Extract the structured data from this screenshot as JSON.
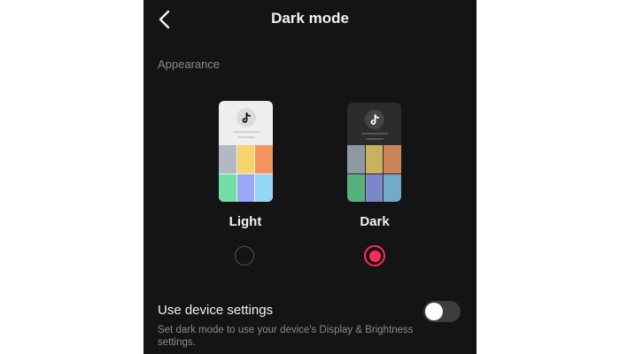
{
  "header": {
    "title": "Dark mode"
  },
  "appearance": {
    "label": "Appearance",
    "options": [
      {
        "label": "Light",
        "selected": false,
        "tiles": [
          "#b3b8c2",
          "#f6d36b",
          "#f2945c",
          "#72e0a4",
          "#9aa6f6",
          "#96d6f6"
        ]
      },
      {
        "label": "Dark",
        "selected": true,
        "tiles": [
          "#8f97a3",
          "#c9b160",
          "#c98458",
          "#58b07e",
          "#7d86c9",
          "#75a9c9"
        ]
      }
    ]
  },
  "device_settings": {
    "title": "Use device settings",
    "description": "Set dark mode to use your device's Display & Brightness settings.",
    "enabled": false
  },
  "colors": {
    "accent": "#fe2c55",
    "background": "#141414",
    "toggle_off": "#3d3d3d"
  },
  "icons": {
    "back": "chevron-left-icon",
    "logo": "tiktok-logo-icon"
  }
}
